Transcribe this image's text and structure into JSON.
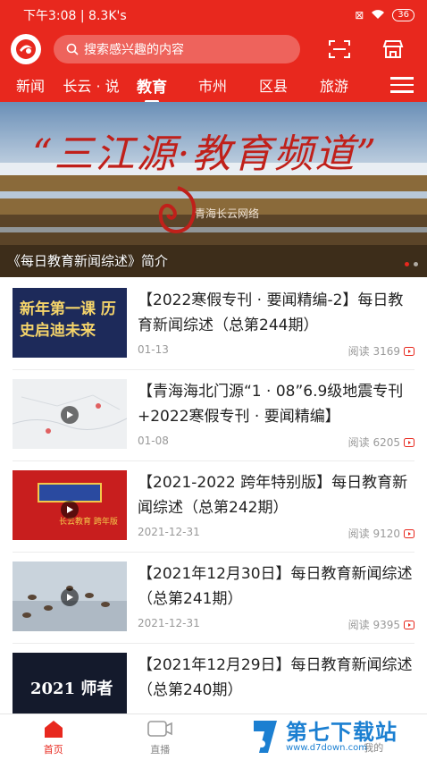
{
  "status": {
    "time": "下午3:08 | 8.3K's",
    "battery": "36"
  },
  "search": {
    "placeholder": "搜索感兴趣的内容"
  },
  "tabs": [
    {
      "label": "新闻"
    },
    {
      "label": "长云 · 说"
    },
    {
      "label": "教育"
    },
    {
      "label": "市州"
    },
    {
      "label": "区县"
    },
    {
      "label": "旅游"
    }
  ],
  "banner": {
    "title": "“三江源·教育频道”",
    "logo_text": "青海长云网络",
    "caption": "《每日教育新闻综述》简介"
  },
  "articles": [
    {
      "title": "【2022寒假专刊 · 要闻精编-2】每日教育新闻综述（总第244期）",
      "date": "01-13",
      "reads": "阅读 3169",
      "thumb_text": "新年第一课 历史启迪未来"
    },
    {
      "title": "【青海海北门源“1 · 08”6.9级地震专刊+2022寒假专刊 · 要闻精编】",
      "date": "01-08",
      "reads": "阅读 6205",
      "thumb_text": ""
    },
    {
      "title": "【2021-2022 跨年特别版】每日教育新闻综述（总第242期）",
      "date": "2021-12-31",
      "reads": "阅读 9120",
      "thumb_text": "长云教育 跨年版"
    },
    {
      "title": "【2021年12月30日】每日教育新闻综述（总第241期）",
      "date": "2021-12-31",
      "reads": "阅读 9395",
      "thumb_text": ""
    },
    {
      "title": "【2021年12月29日】每日教育新闻综述（总第240期）",
      "date": "",
      "reads": "",
      "thumb_text": "2021 师者"
    }
  ],
  "bottom_nav": [
    {
      "label": "首页"
    },
    {
      "label": "直播"
    },
    {
      "label": ""
    },
    {
      "label": "我的"
    }
  ],
  "watermark": {
    "text": "第七下载站",
    "url": "www.d7down.com"
  },
  "colors": {
    "brand": "#e8281e"
  }
}
